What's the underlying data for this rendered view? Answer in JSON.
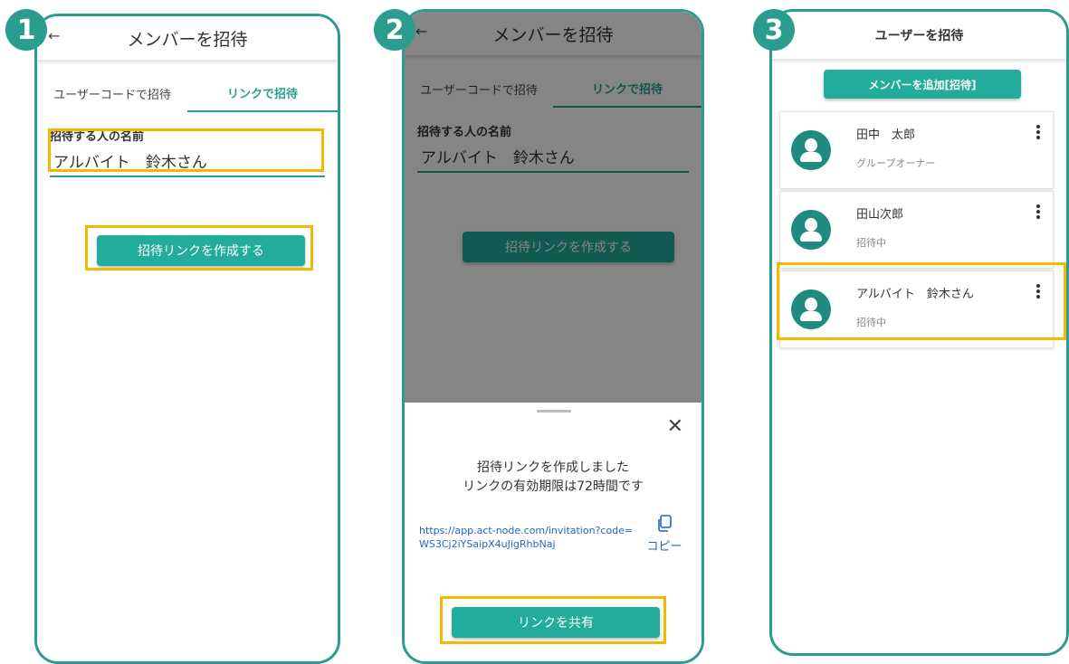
{
  "colors": {
    "accent": "#2a9d8f",
    "button": "#22ac9c",
    "highlight": "#f5b800",
    "link": "#1e66c8"
  },
  "step1": {
    "badge": "1",
    "back_icon": "←",
    "title": "メンバーを招待",
    "tabs": [
      {
        "label": "ユーザーコードで招待",
        "active": false
      },
      {
        "label": "リンクで招待",
        "active": true
      }
    ],
    "field_label": "招待する人の名前",
    "name_value": "アルバイト　鈴木さん",
    "create_button": "招待リンクを作成する"
  },
  "step2": {
    "badge": "2",
    "back_icon": "←",
    "title": "メンバーを招待",
    "tabs": [
      {
        "label": "ユーザーコードで招待",
        "active": false
      },
      {
        "label": "リンクで招待",
        "active": true
      }
    ],
    "field_label": "招待する人の名前",
    "name_value": "アルバイト　鈴木さん",
    "create_button": "招待リンクを作成する",
    "sheet": {
      "close_icon": "✕",
      "message_line1": "招待リンクを作成しました",
      "message_line2": "リンクの有効期限は72時間です",
      "link": "https://app.act-node.com/invitation?code=WS3Cj2iYSaipX4uJigRhbNaj",
      "copy_label": "コピー",
      "share_button": "リンクを共有"
    }
  },
  "step3": {
    "badge": "3",
    "back_icon": "←",
    "title": "ユーザーを招待",
    "add_button": "メンバーを追加[招待]",
    "members": [
      {
        "name": "田中　太郎",
        "role": "グループオーナー"
      },
      {
        "name": "田山次郎",
        "role": "招待中"
      },
      {
        "name": "アルバイト　鈴木さん",
        "role": "招待中"
      }
    ]
  }
}
